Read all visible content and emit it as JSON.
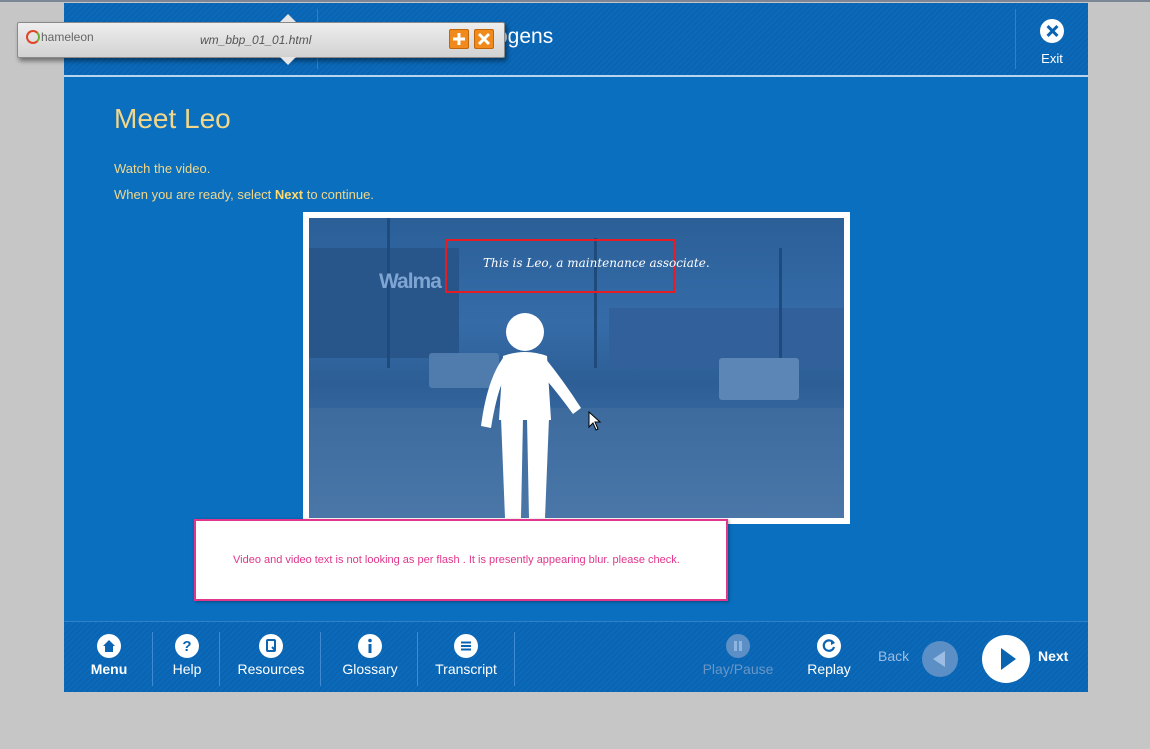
{
  "header": {
    "course_title_fragment": "ogens",
    "exit_label": "Exit"
  },
  "floating_window": {
    "app_name": "hameleon",
    "file_name": "wm_bbp_01_01.html"
  },
  "content": {
    "page_title": "Meet Leo",
    "instruction_1": "Watch the video.",
    "instruction_2_pre": "When you are ready, select ",
    "instruction_2_bold": "Next",
    "instruction_2_post": " to continue.",
    "video_caption": "This is Leo, a maintenance associate.",
    "video_store_sign": "Walma"
  },
  "review_comment": {
    "text": "Video and video text is not looking as per flash . It is presently appearing blur. please check."
  },
  "footer": {
    "menu": "Menu",
    "help": "Help",
    "resources": "Resources",
    "glossary": "Glossary",
    "transcript": "Transcript",
    "play_pause": "Play/Pause",
    "replay": "Replay",
    "back": "Back",
    "next": "Next"
  },
  "colors": {
    "page_bg": "#c6c6c6",
    "frame_blue": "#0a6fbf",
    "title_gold": "#f2d78a",
    "comment_magenta": "#e0368c",
    "caption_border_red": "#e41c23"
  }
}
